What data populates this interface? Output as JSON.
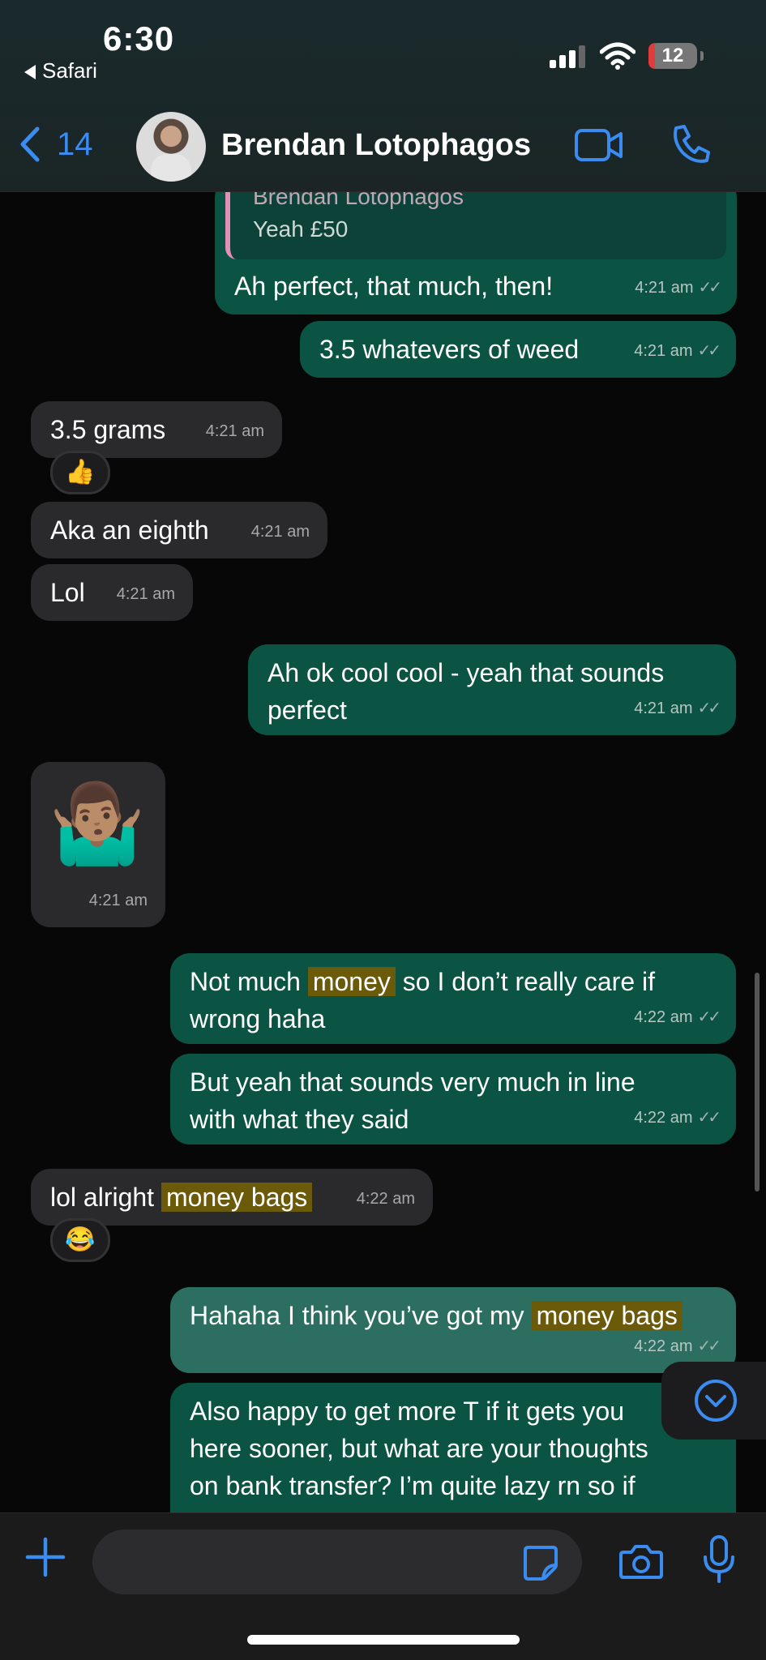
{
  "status_bar": {
    "time": "6:30",
    "back_app": "Safari",
    "battery": "12"
  },
  "header": {
    "back_count": "14",
    "contact_name": "Brendan Lotophagos"
  },
  "quote": {
    "sender": "Brendan Lotophagos",
    "text": "Yeah £50"
  },
  "messages": [
    {
      "text": "Ah perfect, that much, then!",
      "time": "4:21 am"
    },
    {
      "text": "3.5 whatevers of weed",
      "time": "4:21 am"
    },
    {
      "text": "3.5 grams",
      "time": "4:21 am",
      "reaction": "👍"
    },
    {
      "text": "Aka an eighth",
      "time": "4:21 am"
    },
    {
      "text": "Lol",
      "time": "4:21 am"
    },
    {
      "text_line1": "Ah ok cool cool - yeah that sounds",
      "text_line2": "perfect",
      "time": "4:21 am"
    },
    {
      "emoji": "🤷🏽‍♂️",
      "time": "4:21 am"
    },
    {
      "pre": "Not much ",
      "highlight": "money",
      "post": " so I don’t really care if",
      "line2": "wrong haha",
      "time": "4:22 am"
    },
    {
      "text_line1": "But yeah that sounds very much in line",
      "text_line2": "with what they said",
      "time": "4:22 am"
    },
    {
      "pre": "lol alright ",
      "highlight": "money bags",
      "time": "4:22 am",
      "reaction": "😂"
    },
    {
      "pre": "Hahaha I think you’ve got my ",
      "highlight": "money bags",
      "time": "4:22 am"
    },
    {
      "line1": "Also happy to get more T if it gets you",
      "line2": "here sooner, but what are your thoughts",
      "line3": "on bank transfer? I’m quite lazy rn so if"
    }
  ],
  "ticks": "✓✓"
}
